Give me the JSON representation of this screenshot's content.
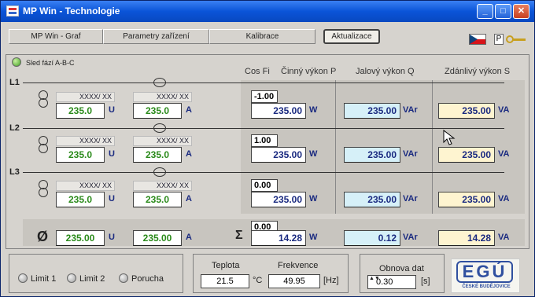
{
  "window": {
    "title": "MP Win - Technologie"
  },
  "menu": {
    "graf": "MP Win - Graf",
    "parametry": "Parametry zařízení",
    "kalibrace": "Kalibrace",
    "aktualizace": "Aktualizace",
    "p_label": "P"
  },
  "sequence": {
    "label": "Sled fází A-B-C"
  },
  "columns": {
    "cos": "Cos Fi",
    "p": "Činný výkon P",
    "q": "Jalový výkon Q",
    "s": "Zdánlivý výkon S"
  },
  "phases": [
    {
      "label": "L1",
      "ratio_u": "XXXX/ XX",
      "ratio_i": "XXXX/ XX",
      "u": "235.0",
      "i": "235.0",
      "cos": "-1.00",
      "p": "235.00",
      "q": "235.00",
      "s": "235.00"
    },
    {
      "label": "L2",
      "ratio_u": "XXXX/ XX",
      "ratio_i": "XXXX/ XX",
      "u": "235.0",
      "i": "235.0",
      "cos": "1.00",
      "p": "235.00",
      "q": "235.00",
      "s": "235.00"
    },
    {
      "label": "L3",
      "ratio_u": "XXXX/ XX",
      "ratio_i": "XXXX/ XX",
      "u": "235.0",
      "i": "235.0",
      "cos": "0.00",
      "p": "235.00",
      "q": "235.00",
      "s": "235.00"
    }
  ],
  "units": {
    "u": "U",
    "i": "A",
    "p": "W",
    "q": "VAr",
    "s": "VA"
  },
  "totals": {
    "avg_symbol": "Ø",
    "sum_symbol": "Σ",
    "u": "235.00",
    "i": "235.00",
    "cos": "0.00",
    "p": "14.28",
    "q": "0.12",
    "s": "14.28"
  },
  "limits": {
    "limit1": "Limit 1",
    "limit2": "Limit 2",
    "porucha": "Porucha"
  },
  "temperature": {
    "label": "Teplota",
    "value": "21.5",
    "unit": "°C"
  },
  "frequency": {
    "label": "Frekvence",
    "value": "49.95",
    "unit": "[Hz]"
  },
  "refresh": {
    "label": "Obnova dat",
    "value": "0.30",
    "unit": "[s]"
  },
  "logo": {
    "text": "EGÚ",
    "sub": "ČESKÉ BUDĚJOVICE"
  },
  "colors": {
    "accent": "#0a54d8",
    "value_green": "#2a8a1a",
    "q_bg": "#d6f0f8",
    "s_bg": "#fef4d0"
  }
}
